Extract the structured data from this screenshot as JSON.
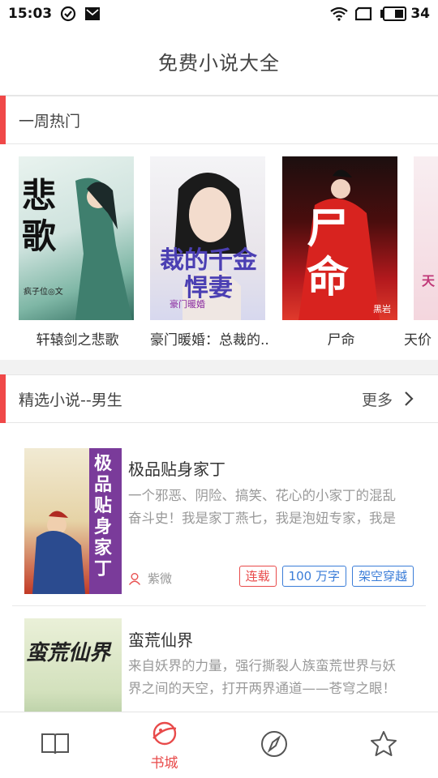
{
  "status_bar": {
    "time": "15:03",
    "battery": "34",
    "icons": [
      "check-circle-icon",
      "mail-icon",
      "wifi-icon",
      "sim-icon",
      "battery-icon"
    ]
  },
  "header": {
    "title": "免费小说大全"
  },
  "weekly_hot": {
    "title": "一周热门",
    "items": [
      {
        "title": "轩辕剑之悲歌",
        "cover_text": "悲歌",
        "cover_sub": "疯子位◎文"
      },
      {
        "title": "豪门暖婚：总裁的..",
        "cover_text": "裁的千金悍妻",
        "cover_sub": "豪门暖婚"
      },
      {
        "title": "尸命",
        "cover_text": "尸命",
        "cover_sub": "黑岩"
      },
      {
        "title": "天价",
        "cover_text": "天",
        "cover_sub": ""
      }
    ]
  },
  "featured_male": {
    "title": "精选小说--男生",
    "more_label": "更多",
    "books": [
      {
        "title": "极品贴身家丁",
        "description": "一个邪恶、阴险、搞笑、花心的小家丁的混乱奋斗史！我是家丁燕七，我是泡妞专家，我是",
        "author": "紫微",
        "cover_text": "极品贴身家丁",
        "tags": [
          "连载",
          "100 万字",
          "架空穿越"
        ]
      },
      {
        "title": "蛮荒仙界",
        "description": "来自妖界的力量，强行撕裂人族蛮荒世界与妖界之间的天空，打开两界通道——苍穹之眼！",
        "author": "",
        "cover_text": "蛮荒仙界",
        "tags": []
      }
    ]
  },
  "bottom_nav": {
    "items": [
      {
        "label": "",
        "icon": "book-open-icon"
      },
      {
        "label": "书城",
        "icon": "planet-icon"
      },
      {
        "label": "",
        "icon": "compass-icon"
      },
      {
        "label": "",
        "icon": "star-icon"
      }
    ]
  },
  "colors": {
    "accent": "#f04848",
    "tag_blue": "#3b7dd8"
  }
}
